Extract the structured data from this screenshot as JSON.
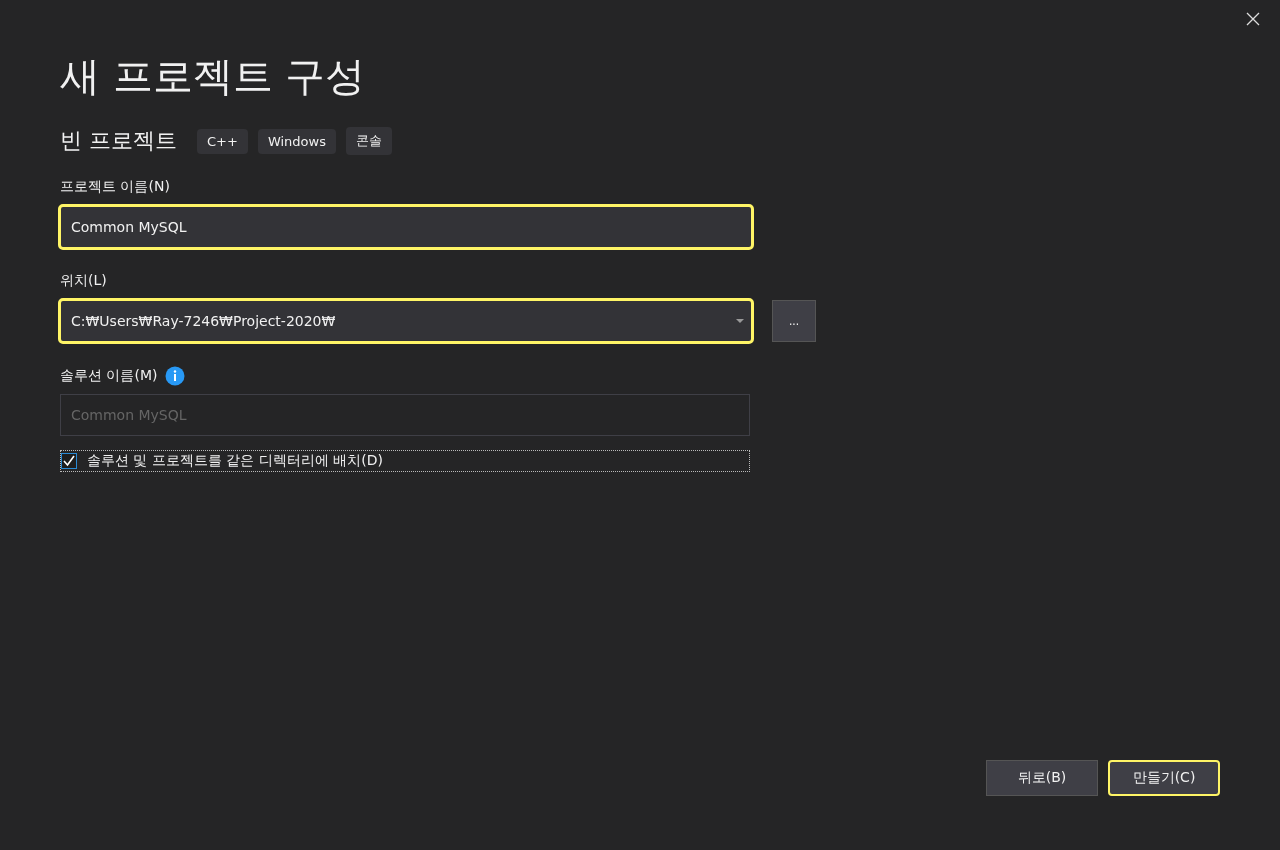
{
  "window": {
    "title": "새 프로젝트 구성"
  },
  "template": {
    "name": "빈 프로젝트",
    "tags": [
      "C++",
      "Windows",
      "콘솔"
    ]
  },
  "project_name": {
    "label": "프로젝트 이름(N)",
    "value": "Common MySQL",
    "highlighted": true
  },
  "location": {
    "label": "위치(L)",
    "value": "C:₩Users₩Ray-7246₩Project-2020₩",
    "highlighted": true,
    "browse_button": "..."
  },
  "solution_name": {
    "label": "솔루션 이름(M)",
    "placeholder": "Common MySQL",
    "disabled": true
  },
  "same_directory": {
    "label": "솔루션 및 프로젝트를 같은 디렉터리에 배치(D)",
    "checked": true
  },
  "buttons": [
    {
      "label": "뒤로(B)",
      "highlighted": false
    },
    {
      "label": "만들기(C)",
      "highlighted": true
    }
  ]
}
